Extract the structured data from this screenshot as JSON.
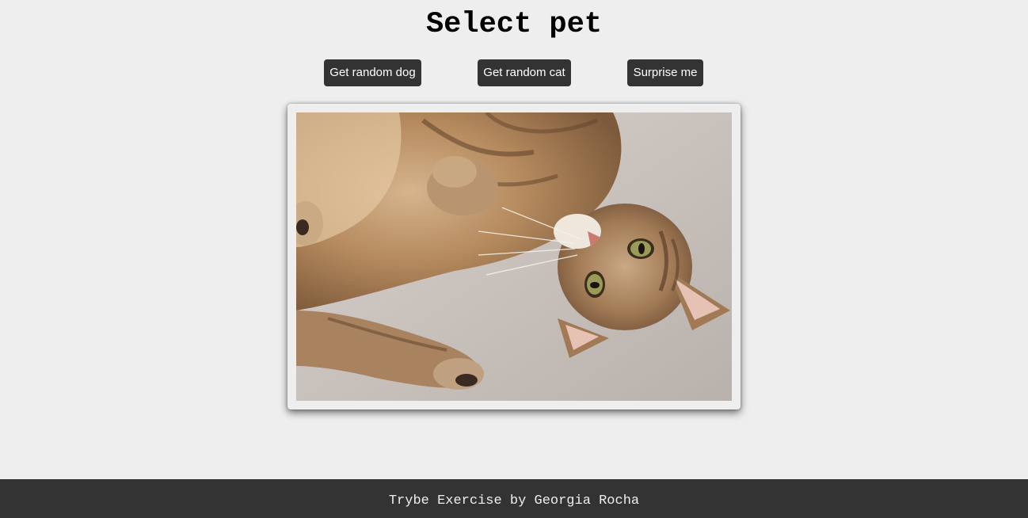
{
  "header": {
    "title": "Select pet"
  },
  "actions": {
    "dog_label": "Get random dog",
    "cat_label": "Get random cat",
    "surprise_label": "Surprise me"
  },
  "pet_image": {
    "alt": "cat",
    "subject": "tabby cat lying on its back on a carpet"
  },
  "footer": {
    "credit": "Trybe Exercise by Georgia Rocha"
  },
  "colors": {
    "background": "#eeeeee",
    "button_bg": "#333333",
    "button_text": "#ffffff",
    "footer_bg": "#333333",
    "footer_text": "#eeeeee"
  }
}
